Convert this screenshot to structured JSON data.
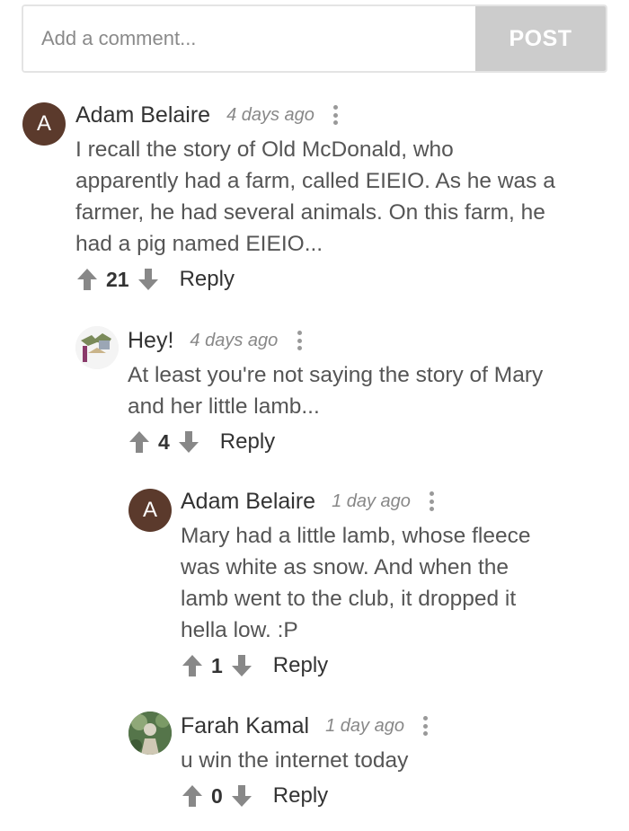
{
  "composer": {
    "placeholder": "Add a comment...",
    "post_label": "POST"
  },
  "comments": [
    {
      "avatar_letter": "A",
      "name": "Adam Belaire",
      "time": "4 days ago",
      "lines": [
        "I recall the story of Old McDonald, who",
        "apparently had a farm, called EIEIO. As he was a",
        "farmer, he had several animals. On this farm, he",
        "had a pig named EIEIO..."
      ],
      "votes": "21",
      "reply_label": "Reply"
    },
    {
      "name": "Hey!",
      "time": "4 days ago",
      "lines": [
        "At least you're not saying the story of Mary",
        "and her little lamb..."
      ],
      "votes": "4",
      "reply_label": "Reply"
    },
    {
      "avatar_letter": "A",
      "name": "Adam Belaire",
      "time": "1 day ago",
      "lines": [
        "Mary had a little lamb, whose fleece",
        "was white as snow. And when the",
        "lamb went to the club, it dropped it",
        "hella low. :P"
      ],
      "votes": "1",
      "reply_label": "Reply"
    },
    {
      "name": "Farah Kamal",
      "time": "1 day ago",
      "lines": [
        "u win the internet today"
      ],
      "votes": "0",
      "reply_label": "Reply"
    }
  ],
  "colors": {
    "avatar_letter_bg": "#5b3a2c",
    "post_button_bg": "#cccccc",
    "vote_icon": "#888888"
  },
  "icons": {
    "upvote": "arrow-up-icon",
    "downvote": "arrow-down-icon",
    "more": "more-vertical-icon"
  }
}
